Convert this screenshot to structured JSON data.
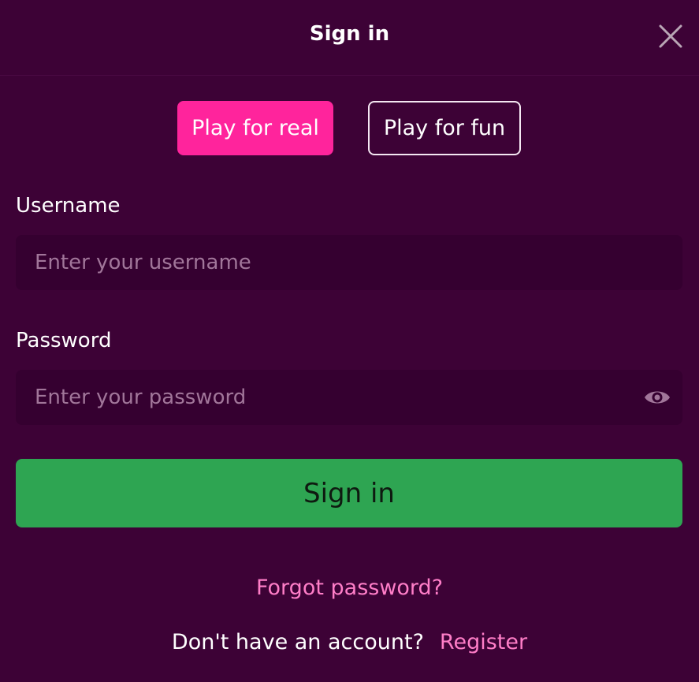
{
  "header": {
    "title": "Sign in",
    "close_icon": "close-icon"
  },
  "mode": {
    "real_label": "Play for real",
    "fun_label": "Play for fun",
    "selected": "Play for real"
  },
  "form": {
    "username": {
      "label": "Username",
      "placeholder": "Enter your username",
      "value": ""
    },
    "password": {
      "label": "Password",
      "placeholder": "Enter your password",
      "value": "",
      "toggle_icon": "eye-icon"
    },
    "submit_label": "Sign in"
  },
  "links": {
    "forgot_password": "Forgot password?",
    "no_account_text": "Don't have an account?",
    "register": "Register"
  },
  "colors": {
    "background": "#3d0236",
    "input_background": "#350030",
    "accent_pink": "#ff249c",
    "link_pink": "#ff7ec8",
    "submit_green": "#2ea552"
  }
}
